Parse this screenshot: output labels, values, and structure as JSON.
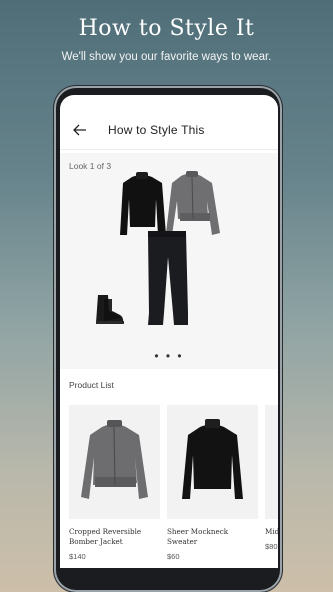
{
  "hero": {
    "title": "How to Style It",
    "subtitle": "We'll show you our favorite ways to wear."
  },
  "app_bar": {
    "back_icon": "arrow-left-icon",
    "title": "How to Style This"
  },
  "look": {
    "label": "Look 1 of 3",
    "pagination": "• • •",
    "items": [
      "black mockneck sweater",
      "grey bomber jacket",
      "black joggers",
      "black lace-up boots"
    ]
  },
  "product_list": {
    "title": "Product List",
    "items": [
      {
        "name": "Cropped Reversible Bomber Jacket",
        "price": "$140"
      },
      {
        "name": "Sheer Mockneck Sweater",
        "price": "$60"
      },
      {
        "name": "Mid",
        "price": "$80"
      }
    ]
  },
  "colors": {
    "accent": "#1a1a1a",
    "background_top": "#4f6e78",
    "background_bottom": "#cdbfa9"
  }
}
